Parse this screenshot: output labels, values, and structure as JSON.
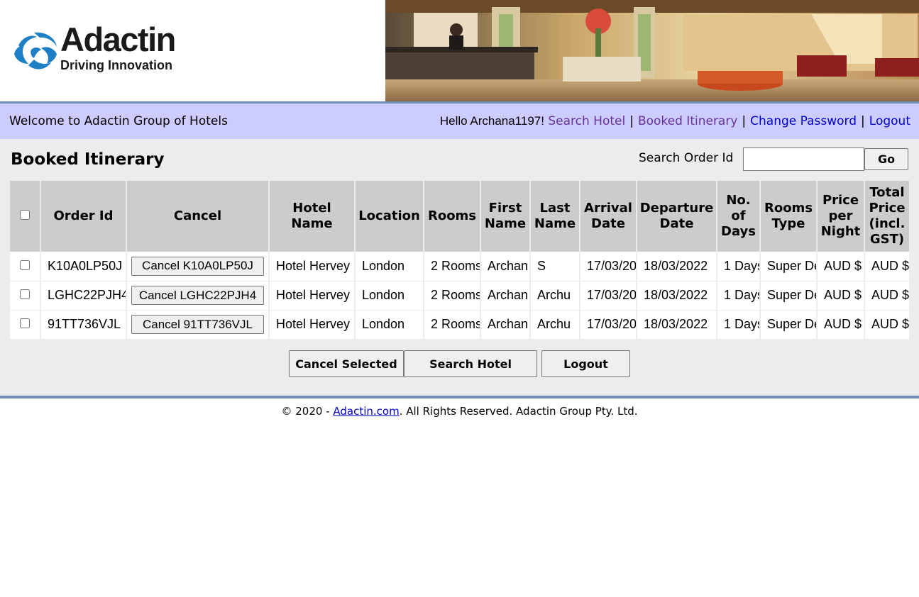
{
  "brand": {
    "name": "Adactin",
    "tagline": "Driving Innovation",
    "colors": {
      "nav_bg": "#ccccff",
      "accent_border": "#6e8fb6",
      "link": "#0000cc",
      "visited_link": "#663399",
      "main_bg": "#ececec",
      "header_cell": "#cccccc"
    }
  },
  "nav": {
    "welcome": "Welcome to Adactin Group of Hotels",
    "greeting": "Hello Archana1197!",
    "links": [
      "Search Hotel",
      "Booked Itinerary",
      "Change Password",
      "Logout"
    ],
    "separator": "|"
  },
  "page": {
    "title": "Booked Itinerary",
    "search_label": "Search Order Id",
    "search_value": "",
    "go_label": "Go"
  },
  "table": {
    "headers": [
      "Order Id",
      "Cancel",
      "Hotel Name",
      "Location",
      "Rooms",
      "First Name",
      "Last Name",
      "Arrival Date",
      "Departure Date",
      "No. of Days",
      "Rooms Type",
      "Price per Night",
      "Total Price (incl. GST)"
    ],
    "rows": [
      {
        "order_id": "K10A0LP50J",
        "cancel": "Cancel K10A0LP50J",
        "hotel": "Hotel Hervey",
        "location": "London",
        "rooms": "2 Rooms",
        "first": "Archan",
        "last": "S",
        "arrival": "17/03/20",
        "departure": "18/03/2022",
        "days": "1 Days",
        "type": "Super De",
        "price": "AUD $",
        "total": "AUD $"
      },
      {
        "order_id": "LGHC22PJH4",
        "cancel": "Cancel LGHC22PJH4",
        "hotel": "Hotel Hervey",
        "location": "London",
        "rooms": "2 Rooms",
        "first": "Archan",
        "last": "Archu",
        "arrival": "17/03/20",
        "departure": "18/03/2022",
        "days": "1 Days",
        "type": "Super De",
        "price": "AUD $",
        "total": "AUD $"
      },
      {
        "order_id": "91TT736VJL",
        "cancel": "Cancel 91TT736VJL",
        "hotel": "Hotel Hervey",
        "location": "London",
        "rooms": "2 Rooms",
        "first": "Archan",
        "last": "Archu",
        "arrival": "17/03/20",
        "departure": "18/03/2022",
        "days": "1 Days",
        "type": "Super De",
        "price": "AUD $",
        "total": "AUD $"
      }
    ]
  },
  "actions": {
    "cancel_selected": "Cancel Selected",
    "search_hotel": "Search Hotel",
    "logout": "Logout"
  },
  "footer": {
    "prefix": "© 2020 - ",
    "link": "Adactin.com",
    "suffix": ". All Rights Reserved. Adactin Group Pty. Ltd."
  }
}
